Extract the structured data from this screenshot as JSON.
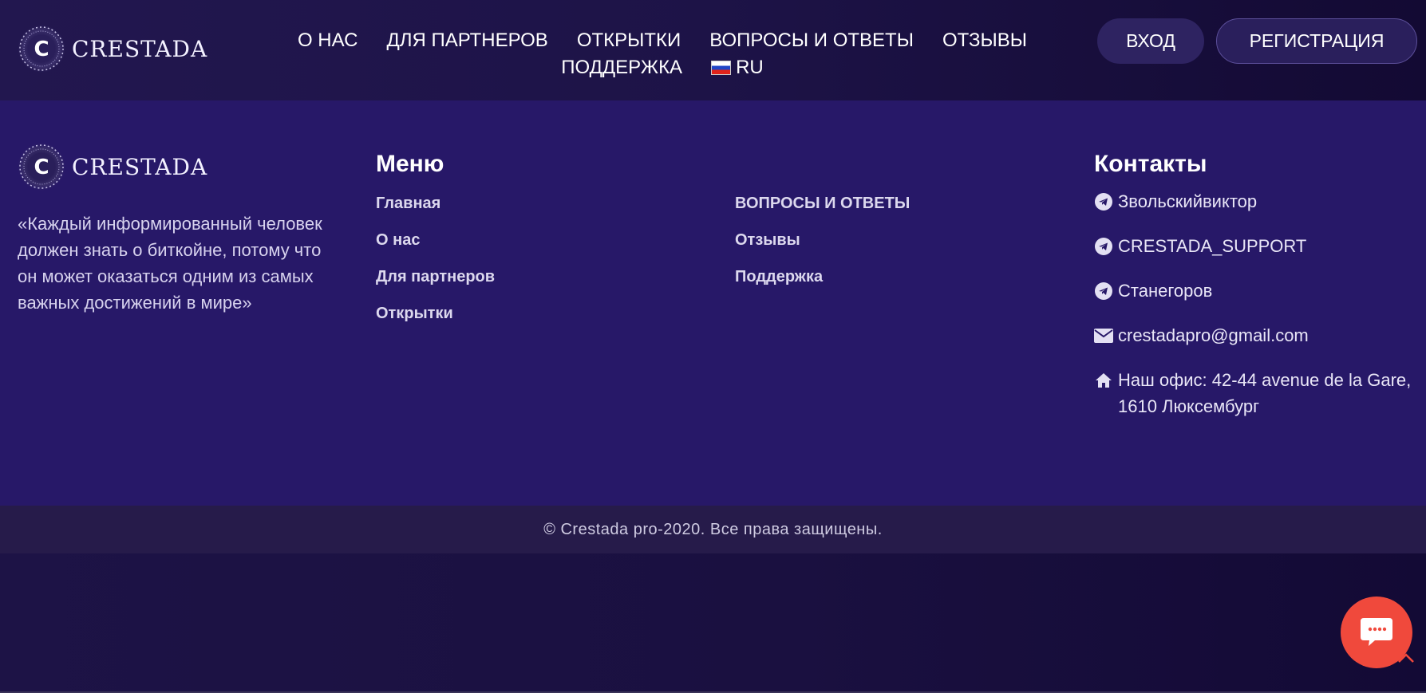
{
  "header": {
    "logo_text": "CRESTADA",
    "nav": [
      {
        "label": "О НАС"
      },
      {
        "label": "ДЛЯ ПАРТНЕРОВ"
      },
      {
        "label": "ОТКРЫТКИ"
      },
      {
        "label": "ВОПРОСЫ И ОТВЕТЫ"
      },
      {
        "label": "ОТЗЫВЫ"
      },
      {
        "label": "ПОДДЕРЖКА"
      }
    ],
    "language": "RU",
    "login_label": "ВХОД",
    "register_label": "РЕГИСТРАЦИЯ"
  },
  "footer": {
    "logo_text": "CRESTADA",
    "quote": "«Каждый информированный человек должен знать о биткойне, потому что он может оказаться одним из самых важных достижений в мире»",
    "menu_title": "Меню",
    "menu_col1": [
      "Главная",
      "О нас",
      "Для партнеров",
      "Открытки"
    ],
    "menu_col2": [
      "ВОПРОСЫ И ОТВЕТЫ",
      "Отзывы",
      "Поддержка"
    ],
    "contacts_title": "Контакты",
    "contacts": [
      {
        "icon": "telegram-icon",
        "text": "Звольскийвиктор"
      },
      {
        "icon": "telegram-icon",
        "text": "CRESTADA_SUPPORT"
      },
      {
        "icon": "telegram-icon",
        "text": "Станегоров"
      },
      {
        "icon": "envelope-icon",
        "text": "crestadapro@gmail.com"
      },
      {
        "icon": "home-icon",
        "text": "Наш офис: 42-44 avenue de la Gare, 1610 Люксембург"
      }
    ],
    "copyright": "© Crestada pro-2020. Все права защищены."
  },
  "colors": {
    "header_bg": "#1d1347",
    "footer_bg": "#271868",
    "copyright_bg": "#261b4a",
    "chat_button": "#f0493c"
  }
}
